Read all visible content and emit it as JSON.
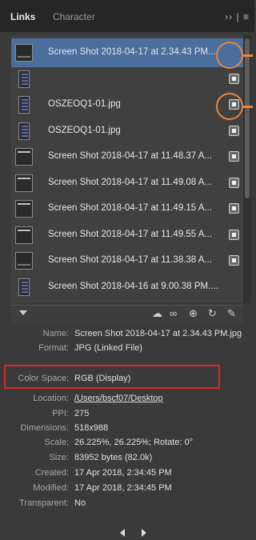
{
  "tabs": [
    {
      "label": "Links",
      "active": true
    },
    {
      "label": "Character",
      "active": false
    }
  ],
  "panel_menu": "›› |  ≡",
  "links": [
    {
      "name": "Screen Shot 2018-04-17 at 2.34.43 PM....",
      "selected": true,
      "thumb": "screenshot-dark",
      "status_icon": false
    },
    {
      "name": "",
      "selected": false,
      "thumb": "portrait-image",
      "status_icon": true
    },
    {
      "name": "OSZEOQ1-01.jpg",
      "selected": false,
      "thumb": "portrait-image",
      "status_icon": true
    },
    {
      "name": "OSZEOQ1-01.jpg",
      "selected": false,
      "thumb": "portrait-image",
      "status_icon": true
    },
    {
      "name": "Screen Shot 2018-04-17 at 11.48.37 A...",
      "selected": false,
      "thumb": "screenshot-window",
      "status_icon": true
    },
    {
      "name": "Screen Shot 2018-04-17 at 11.49.08 A...",
      "selected": false,
      "thumb": "screenshot-window",
      "status_icon": true
    },
    {
      "name": "Screen Shot 2018-04-17 at 11.49.15 A...",
      "selected": false,
      "thumb": "screenshot-window",
      "status_icon": true
    },
    {
      "name": "Screen Shot 2018-04-17 at 11.49.55 A...",
      "selected": false,
      "thumb": "screenshot-window",
      "status_icon": true
    },
    {
      "name": "Screen Shot 2018-04-17 at 11.38.38 A...",
      "selected": false,
      "thumb": "screenshot-dark",
      "status_icon": true
    },
    {
      "name": "Screen Shot 2018-04-16 at 9.00.38 PM....",
      "selected": false,
      "thumb": "portrait-image",
      "status_icon": false
    }
  ],
  "toolbar": {
    "icons": [
      "cloud-link-icon",
      "chain-link-icon",
      "go-to-link-icon",
      "update-link-icon",
      "edit-original-icon"
    ],
    "glyphs": [
      "☁",
      "∞",
      "⊕",
      "↻",
      "✎"
    ]
  },
  "info": [
    {
      "label": "Name:",
      "value": "Screen Shot 2018-04-17 at 2.34.43 PM.jpg"
    },
    {
      "label": "Format:",
      "value": "JPG (Linked File)"
    },
    {
      "label": "Color Space:",
      "value": "RGB (Display)"
    },
    {
      "label": "Location:",
      "value": "/Users/bscf07/Desktop"
    },
    {
      "label": "PPI:",
      "value": "275"
    },
    {
      "label": "Dimensions:",
      "value": "518x988"
    },
    {
      "label": "Scale:",
      "value": "26.225%, 26.225%; Rotate: 0°"
    },
    {
      "label": "Size:",
      "value": "83952 bytes (82.0k)"
    },
    {
      "label": "Created:",
      "value": "17 Apr 2018, 2:34:45 PM"
    },
    {
      "label": "Modified:",
      "value": "17 Apr 2018, 2:34:45 PM"
    },
    {
      "label": "Transparent:",
      "value": "No"
    }
  ],
  "colors": {
    "selection": "#4a6e9e",
    "annotation_circle": "#e8863a",
    "annotation_rect": "#e02828"
  }
}
